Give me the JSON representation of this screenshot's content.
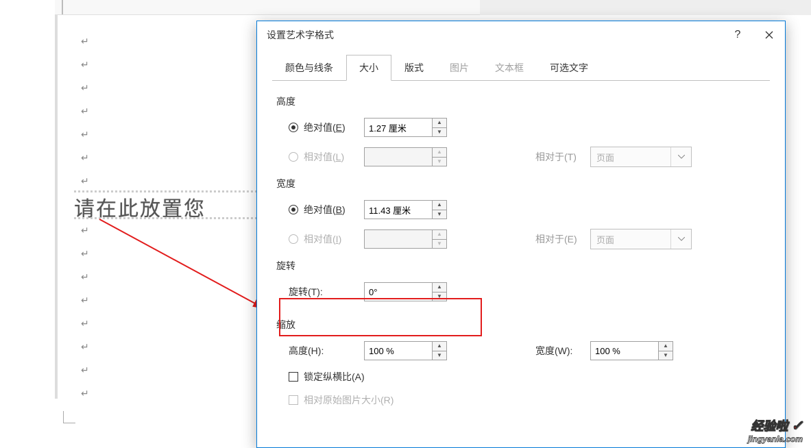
{
  "doc": {
    "wordart_placeholder": "请在此放置您",
    "paragraph_mark": "↵"
  },
  "dialog": {
    "title": "设置艺术字格式",
    "help_icon": "?",
    "tabs": {
      "colors_lines": "颜色与线条",
      "size": "大小",
      "layout": "版式",
      "picture": "图片",
      "textbox": "文本框",
      "alt_text": "可选文字"
    },
    "height": {
      "section": "高度",
      "absolute_label_pre": "绝对值(",
      "absolute_hotkey": "E",
      "absolute_label_post": ")",
      "absolute_value": "1.27 厘米",
      "relative_label_pre": "相对值(",
      "relative_hotkey": "L",
      "relative_label_post": ")",
      "relative_value": "",
      "relative_to_pre": "相对于(",
      "relative_to_hotkey": "T",
      "relative_to_post": ")",
      "relative_to_option": "页面"
    },
    "width": {
      "section": "宽度",
      "absolute_label_pre": "绝对值(",
      "absolute_hotkey": "B",
      "absolute_label_post": ")",
      "absolute_value": "11.43 厘米",
      "relative_label_pre": "相对值(",
      "relative_hotkey": "I",
      "relative_label_post": ")",
      "relative_value": "",
      "relative_to_pre": "相对于(",
      "relative_to_hotkey": "E",
      "relative_to_post": ")",
      "relative_to_option": "页面"
    },
    "rotation": {
      "section": "旋转",
      "label_pre": "旋转(",
      "hotkey": "T",
      "label_post": "):",
      "value": "0°"
    },
    "scale": {
      "section": "缩放",
      "height_pre": "高度(",
      "height_hotkey": "H",
      "height_post": "):",
      "height_value": "100 %",
      "width_pre": "宽度(",
      "width_hotkey": "W",
      "width_post": "):",
      "width_value": "100 %",
      "lock_pre": "锁定纵横比(",
      "lock_hotkey": "A",
      "lock_post": ")",
      "orig_pre": "相对原始图片大小(",
      "orig_hotkey": "R",
      "orig_post": ")"
    }
  },
  "watermark": {
    "brand": "经验啦",
    "url": "jingyanla.com"
  }
}
